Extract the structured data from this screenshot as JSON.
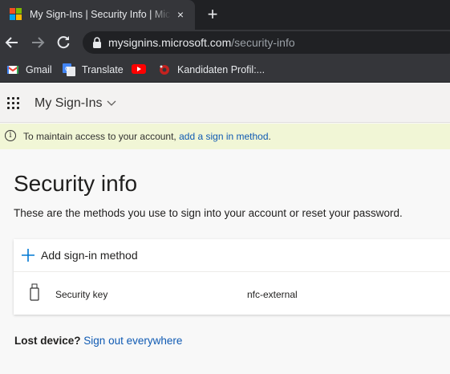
{
  "browser": {
    "tab": {
      "title": "My Sign-Ins | Security Info | Microsoft",
      "close_icon": "×"
    },
    "new_tab_icon": "+",
    "url": {
      "host": "mysignins.microsoft.com",
      "path": "/security-info"
    },
    "bookmarks": [
      {
        "label": "Gmail",
        "icon": "gmail-icon"
      },
      {
        "label": "Translate",
        "icon": "google-translate-icon"
      },
      {
        "label": "",
        "icon": "youtube-icon"
      },
      {
        "label": "Kandidaten Profil:...",
        "icon": "profile-site-icon"
      }
    ]
  },
  "app": {
    "title": "My Sign-Ins"
  },
  "banner": {
    "text": "To maintain access to your account, ",
    "link": "add a sign in method",
    "suffix": "."
  },
  "page": {
    "heading": "Security info",
    "description": "These are the methods you use to sign into your account or reset your password."
  },
  "methods": {
    "add_label": "Add sign-in method",
    "items": [
      {
        "type": "Security key",
        "value": "nfc-external"
      }
    ]
  },
  "footer": {
    "question": "Lost device?",
    "link": "Sign out everywhere"
  },
  "colors": {
    "accent": "#0078d4",
    "link": "#0f5ab3",
    "banner_bg": "#f1f6d6",
    "chrome_dark": "#202124",
    "chrome_toolbar": "#35363a"
  }
}
